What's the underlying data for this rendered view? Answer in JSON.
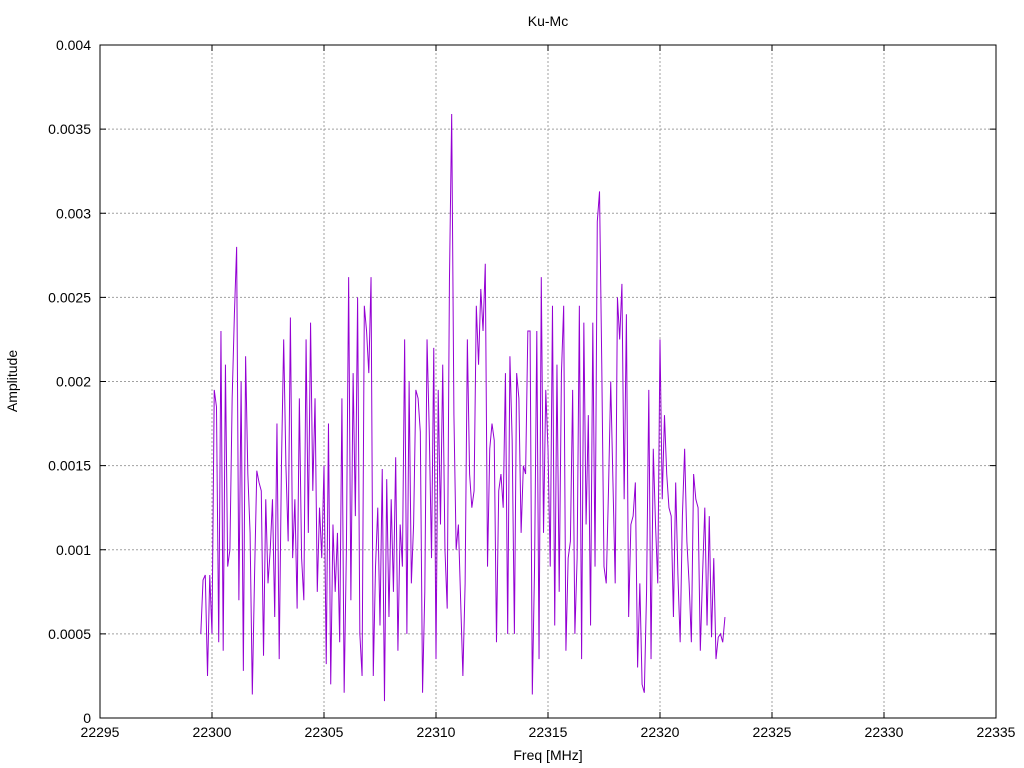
{
  "chart_data": {
    "type": "line",
    "title": "Ku-Mc",
    "xlabel": "Freq [MHz]",
    "ylabel": "Amplitude",
    "xlim": [
      22295,
      22335
    ],
    "ylim": [
      0,
      0.004
    ],
    "x_ticks": [
      "22295",
      "22300",
      "22305",
      "22310",
      "22315",
      "22320",
      "22325",
      "22330",
      "22335"
    ],
    "y_ticks": [
      "0",
      "0.0005",
      "0.001",
      "0.0015",
      "0.002",
      "0.0025",
      "0.003",
      "0.0035",
      "0.004"
    ],
    "grid": true,
    "series_color": "#9400d3",
    "series": [
      {
        "x_start": 22299.5,
        "x_step": 0.1,
        "values": [
          0.0005,
          0.00082,
          0.00085,
          0.00025,
          0.00085,
          0.0005,
          0.00195,
          0.00185,
          0.00045,
          0.0023,
          0.0004,
          0.0021,
          0.0009,
          0.001,
          0.0019,
          0.0024,
          0.0028,
          0.0007,
          0.002,
          0.00028,
          0.00215,
          0.00145,
          0.0011,
          0.00014,
          0.00085,
          0.00147,
          0.0014,
          0.00135,
          0.00037,
          0.0013,
          0.0008,
          0.001,
          0.0013,
          0.0006,
          0.00175,
          0.00035,
          0.0015,
          0.00225,
          0.0015,
          0.00105,
          0.00238,
          0.00095,
          0.0013,
          0.00065,
          0.0019,
          0.00095,
          0.0007,
          0.00225,
          0.0011,
          0.00235,
          0.00135,
          0.0019,
          0.00075,
          0.00125,
          0.00095,
          0.0015,
          0.00032,
          0.00175,
          0.0002,
          0.00115,
          0.00075,
          0.0011,
          0.00045,
          0.0019,
          0.00015,
          0.001,
          0.00262,
          0.0007,
          0.00205,
          0.0012,
          0.0025,
          0.0005,
          0.00025,
          0.00245,
          0.0023,
          0.00205,
          0.00262,
          0.00025,
          0.0009,
          0.00125,
          0.00055,
          0.00148,
          0.0001,
          0.00142,
          0.0006,
          0.0013,
          0.00075,
          0.00155,
          0.0004,
          0.00115,
          0.0009,
          0.00225,
          0.0005,
          0.002,
          0.0008,
          0.00115,
          0.00195,
          0.0019,
          0.0017,
          0.00015,
          0.00075,
          0.00225,
          0.0017,
          0.00095,
          0.0022,
          0.00035,
          0.00195,
          0.00115,
          0.0021,
          0.001,
          0.00065,
          0.0026,
          0.00359,
          0.0018,
          0.001,
          0.00115,
          0.0007,
          0.00025,
          0.0008,
          0.00225,
          0.00145,
          0.00125,
          0.00135,
          0.00245,
          0.0021,
          0.00255,
          0.0023,
          0.0027,
          0.0009,
          0.0016,
          0.00175,
          0.00165,
          0.00045,
          0.00135,
          0.00145,
          0.00125,
          0.00205,
          0.0005,
          0.00215,
          0.00165,
          0.0005,
          0.00205,
          0.0019,
          0.0011,
          0.0015,
          0.00145,
          0.0023,
          0.0023,
          0.00014,
          0.0009,
          0.0023,
          0.00035,
          0.00262,
          0.0011,
          0.00195,
          0.0016,
          0.0009,
          0.00245,
          0.00055,
          0.0021,
          0.00075,
          0.00205,
          0.00245,
          0.0004,
          0.00095,
          0.00105,
          0.00195,
          0.0005,
          0.00095,
          0.00245,
          0.00035,
          0.00235,
          0.00115,
          0.0018,
          0.00055,
          0.00235,
          0.0009,
          0.00295,
          0.00313,
          0.0021,
          0.0009,
          0.0008,
          0.00135,
          0.002,
          0.0014,
          0.0008,
          0.0025,
          0.00225,
          0.00258,
          0.0013,
          0.0024,
          0.0006,
          0.00115,
          0.0012,
          0.0014,
          0.0003,
          0.0008,
          0.0002,
          0.00015,
          0.00075,
          0.00195,
          0.00035,
          0.0016,
          0.00115,
          0.0008,
          0.00225,
          0.0013,
          0.0018,
          0.00145,
          0.00125,
          0.0012,
          0.0006,
          0.0014,
          0.00085,
          0.00045,
          0.0012,
          0.0016,
          0.00105,
          0.0008,
          0.00045,
          0.00145,
          0.0013,
          0.00125,
          0.0004,
          0.00085,
          0.00125,
          0.00055,
          0.0012,
          0.00048,
          0.00095,
          0.00035,
          0.00048,
          0.0005,
          0.00045,
          0.0006
        ]
      }
    ]
  }
}
